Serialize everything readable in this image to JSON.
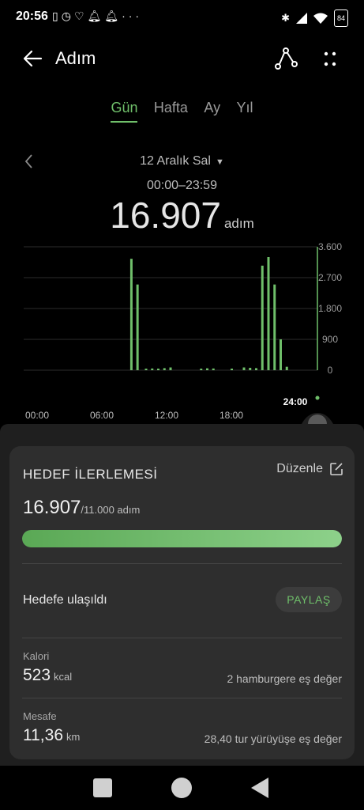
{
  "status_bar": {
    "time": "20:56",
    "left_icons": [
      "vibrate-icon",
      "alarm-icon",
      "health-icon",
      "bell-icon",
      "bell-icon",
      "more-dots-icon"
    ],
    "right_icons": [
      "bluetooth-icon",
      "signal-icon",
      "wifi-icon",
      "battery-icon"
    ],
    "battery": "84"
  },
  "app_bar": {
    "title": "Adım",
    "back_icon": "arrow-left-icon",
    "route_icon": "route-share-icon",
    "more_icon": "more-vertical-icon"
  },
  "tabs": [
    {
      "label": "Gün",
      "active": true
    },
    {
      "label": "Hafta",
      "active": false
    },
    {
      "label": "Ay",
      "active": false
    },
    {
      "label": "Yıl",
      "active": false
    }
  ],
  "date": {
    "label": "12 Aralık Sal",
    "time_range": "00:00–23:59",
    "total": "16.907",
    "unit": "adım"
  },
  "chart_data": {
    "type": "bar",
    "y_ticks": [
      "3.600",
      "2.700",
      "1.800",
      "900",
      "0"
    ],
    "ylim": [
      0,
      3600
    ],
    "x_ticks": [
      "00:00",
      "06:00",
      "12:00",
      "18:00"
    ],
    "cursor_label": "24:00",
    "bars_by_hour": [
      {
        "h": 8.8,
        "v": 3250
      },
      {
        "h": 9.3,
        "v": 2500
      },
      {
        "h": 10.0,
        "v": 40
      },
      {
        "h": 10.5,
        "v": 50
      },
      {
        "h": 11.0,
        "v": 45
      },
      {
        "h": 11.5,
        "v": 60
      },
      {
        "h": 12.0,
        "v": 80
      },
      {
        "h": 14.5,
        "v": 40
      },
      {
        "h": 15.0,
        "v": 55
      },
      {
        "h": 15.5,
        "v": 50
      },
      {
        "h": 17.0,
        "v": 30
      },
      {
        "h": 18.0,
        "v": 80
      },
      {
        "h": 18.5,
        "v": 70
      },
      {
        "h": 19.0,
        "v": 60
      },
      {
        "h": 19.5,
        "v": 3050
      },
      {
        "h": 20.0,
        "v": 3300
      },
      {
        "h": 20.5,
        "v": 2500
      },
      {
        "h": 21.0,
        "v": 900
      },
      {
        "h": 21.5,
        "v": 100
      }
    ],
    "bar_color": "#6fbf6a"
  },
  "goal": {
    "title": "HEDEF İLERLEMESİ",
    "edit_label": "Düzenle",
    "edit_icon": "edit-square-icon",
    "value": "16.907",
    "goal_text": "/11.000 adım",
    "progress": 1.0,
    "reached_label": "Hedefe ulaşıldı",
    "share_label": "PAYLAŞ"
  },
  "metrics": {
    "calorie": {
      "label": "Kalori",
      "value": "523",
      "unit": "kcal",
      "equivalent": "2 hamburgere eş değer"
    },
    "distance": {
      "label": "Mesafe",
      "value": "11,36",
      "unit": "km",
      "equivalent": "28,40 tur yürüyüşe eş değer"
    }
  },
  "colors": {
    "accent": "#6fbf6a",
    "background": "#000000",
    "card": "#2e2e2e"
  }
}
